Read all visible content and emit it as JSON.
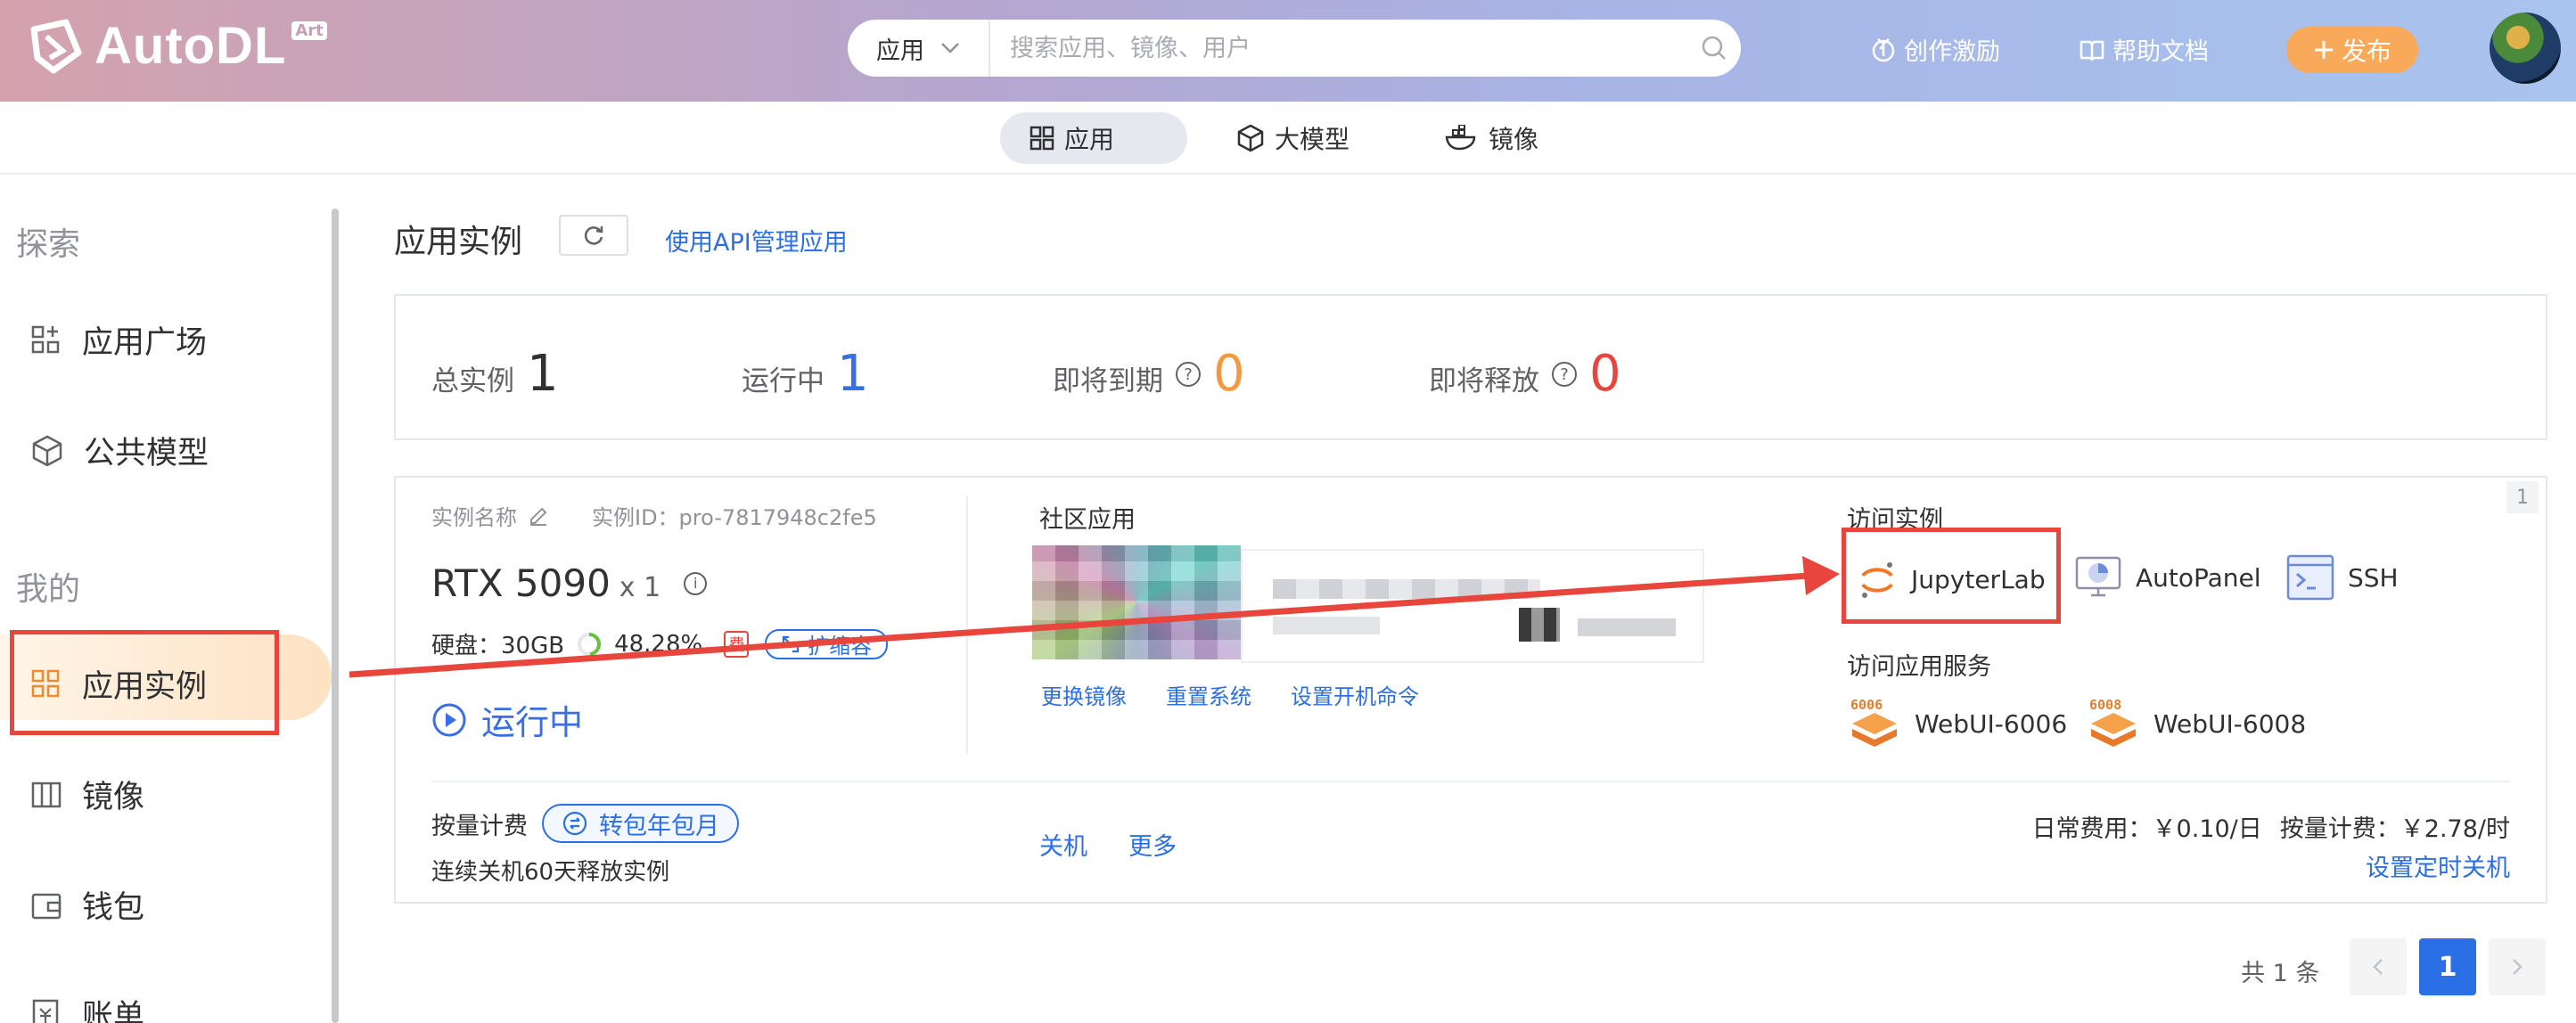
{
  "header": {
    "logo_text": "AutoDL",
    "logo_badge": "Art",
    "search": {
      "scope": "应用",
      "placeholder": "搜索应用、镜像、用户"
    },
    "links": {
      "incentive": "创作激励",
      "docs": "帮助文档"
    },
    "publish": "发布"
  },
  "tabs": [
    {
      "label": "应用"
    },
    {
      "label": "大模型"
    },
    {
      "label": "镜像"
    }
  ],
  "sidebar": {
    "explore": "探索",
    "mine": "我的",
    "items": [
      {
        "label": "应用广场",
        "icon": "apps-add-icon"
      },
      {
        "label": "公共模型",
        "icon": "cube-icon"
      },
      {
        "label": "应用实例",
        "icon": "grid-icon"
      },
      {
        "label": "镜像",
        "icon": "image-icon"
      },
      {
        "label": "钱包",
        "icon": "wallet-icon"
      },
      {
        "label": "账单",
        "icon": "bill-icon"
      }
    ]
  },
  "main": {
    "title": "应用实例",
    "api_link": "使用API管理应用",
    "stats": [
      {
        "label": "总实例",
        "value": "1",
        "color": "#303133"
      },
      {
        "label": "运行中",
        "value": "1",
        "color": "#3a6ee8"
      },
      {
        "label": "即将到期",
        "value": "0",
        "color": "#f29a3d"
      },
      {
        "label": "即将释放",
        "value": "0",
        "color": "#e8453c"
      }
    ],
    "instance": {
      "index": "1",
      "name_label": "实例名称",
      "id_label": "实例ID：pro-7817948c2fe5",
      "gpu": "RTX 5090",
      "gpu_count": "x 1",
      "disk": "硬盘：30GB",
      "disk_pct": "48.28%",
      "disk_fill": 0.4828,
      "fee_badge": "费",
      "resize": "扩缩容",
      "status": "运行中",
      "community_label": "社区应用",
      "actions": [
        "更换镜像",
        "重置系统",
        "设置开机命令"
      ],
      "access_label": "访问实例",
      "access": [
        "JupyterLab",
        "AutoPanel",
        "SSH"
      ],
      "service_label": "访问应用服务",
      "services": [
        {
          "label": "WebUI-6006",
          "port": "6006"
        },
        {
          "label": "WebUI-6008",
          "port": "6008"
        }
      ],
      "billing_label": "按量计费",
      "convert_btn": "转包年包月",
      "release_note": "连续关机60天释放实例",
      "power_off": "关机",
      "more": "更多",
      "daily_fee": "日常费用：￥0.10/日",
      "hourly_fee": "按量计费：￥2.78/时",
      "schedule_off": "设置定时关机"
    },
    "pagination": {
      "total": "共 1 条",
      "page": "1"
    }
  },
  "colors": {
    "accent": "#2b6fe6",
    "annotation": "#e8453c",
    "publish": "#f8a95a"
  }
}
